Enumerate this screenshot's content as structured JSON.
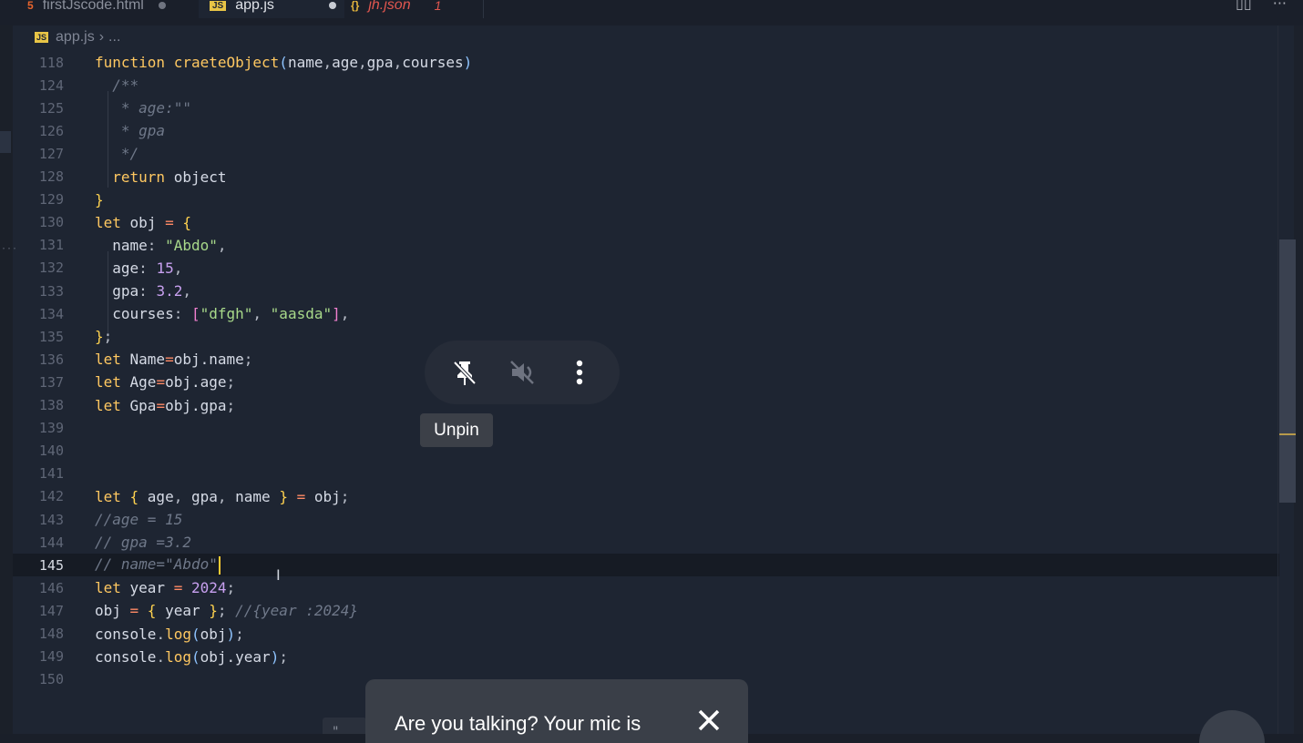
{
  "tabs": [
    {
      "label": "firstJscode.html",
      "icon": "html5-icon",
      "modified": true
    },
    {
      "label": "app.js",
      "icon": "js-file-icon",
      "modified": true,
      "active": true
    },
    {
      "label": "jh.json",
      "icon": "json-braces-icon",
      "problems": "1"
    }
  ],
  "breadcrumb": {
    "file": "app.js",
    "rest": "..."
  },
  "lines": [
    {
      "n": "118",
      "tokens": [
        [
          "kw",
          "function "
        ],
        [
          "fn",
          "craeteObject"
        ],
        [
          "par",
          "("
        ],
        [
          "id",
          "name"
        ],
        [
          "pu",
          ","
        ],
        [
          "id",
          "age"
        ],
        [
          "pu",
          ","
        ],
        [
          "id",
          "gpa"
        ],
        [
          "pu",
          ","
        ],
        [
          "id",
          "courses"
        ],
        [
          "par",
          ")"
        ]
      ]
    },
    {
      "n": "124",
      "tokens": [
        [
          "cm",
          "  /**"
        ]
      ]
    },
    {
      "n": "125",
      "tokens": [
        [
          "cm",
          "   * age:\"\""
        ]
      ]
    },
    {
      "n": "126",
      "tokens": [
        [
          "cm",
          "   * gpa"
        ]
      ]
    },
    {
      "n": "127",
      "tokens": [
        [
          "cm",
          "   */"
        ]
      ]
    },
    {
      "n": "128",
      "tokens": [
        [
          "kw",
          "  return "
        ],
        [
          "id",
          "object"
        ]
      ]
    },
    {
      "n": "129",
      "tokens": [
        [
          "br",
          "}"
        ]
      ]
    },
    {
      "n": "130",
      "tokens": [
        [
          "kw",
          "let "
        ],
        [
          "id",
          "obj "
        ],
        [
          "op",
          "= "
        ],
        [
          "br",
          "{"
        ]
      ]
    },
    {
      "n": "131",
      "tokens": [
        [
          "id",
          "  name"
        ],
        [
          "pu",
          ": "
        ],
        [
          "str",
          "\"Abdo\""
        ],
        [
          "pu",
          ","
        ]
      ]
    },
    {
      "n": "132",
      "tokens": [
        [
          "id",
          "  age"
        ],
        [
          "pu",
          ": "
        ],
        [
          "num",
          "15"
        ],
        [
          "pu",
          ","
        ]
      ]
    },
    {
      "n": "133",
      "tokens": [
        [
          "id",
          "  gpa"
        ],
        [
          "pu",
          ": "
        ],
        [
          "num",
          "3.2"
        ],
        [
          "pu",
          ","
        ]
      ]
    },
    {
      "n": "134",
      "tokens": [
        [
          "id",
          "  courses"
        ],
        [
          "pu",
          ": "
        ],
        [
          "sq",
          "["
        ],
        [
          "str",
          "\"dfgh\""
        ],
        [
          "pu",
          ", "
        ],
        [
          "str",
          "\"aasda\""
        ],
        [
          "sq",
          "]"
        ],
        [
          "pu",
          ","
        ]
      ]
    },
    {
      "n": "135",
      "tokens": [
        [
          "br",
          "}"
        ],
        [
          "pu",
          ";"
        ]
      ]
    },
    {
      "n": "136",
      "tokens": [
        [
          "kw",
          "let "
        ],
        [
          "id",
          "Name"
        ],
        [
          "op",
          "="
        ],
        [
          "id",
          "obj.name"
        ],
        [
          "pu",
          ";"
        ]
      ]
    },
    {
      "n": "137",
      "tokens": [
        [
          "kw",
          "let "
        ],
        [
          "id",
          "Age"
        ],
        [
          "op",
          "="
        ],
        [
          "id",
          "obj.age"
        ],
        [
          "pu",
          ";"
        ]
      ]
    },
    {
      "n": "138",
      "tokens": [
        [
          "kw",
          "let "
        ],
        [
          "id",
          "Gpa"
        ],
        [
          "op",
          "="
        ],
        [
          "id",
          "obj.gpa"
        ],
        [
          "pu",
          ";"
        ]
      ]
    },
    {
      "n": "139",
      "tokens": []
    },
    {
      "n": "140",
      "tokens": []
    },
    {
      "n": "141",
      "tokens": []
    },
    {
      "n": "142",
      "tokens": [
        [
          "kw",
          "let "
        ],
        [
          "br",
          "{ "
        ],
        [
          "id",
          "age"
        ],
        [
          "pu",
          ", "
        ],
        [
          "id",
          "gpa"
        ],
        [
          "pu",
          ", "
        ],
        [
          "id",
          "name "
        ],
        [
          "br",
          "} "
        ],
        [
          "op",
          "= "
        ],
        [
          "id",
          "obj"
        ],
        [
          "pu",
          ";"
        ]
      ]
    },
    {
      "n": "143",
      "tokens": [
        [
          "cm",
          "//age = 15"
        ]
      ]
    },
    {
      "n": "144",
      "tokens": [
        [
          "cm",
          "// gpa =3.2"
        ]
      ]
    },
    {
      "n": "145",
      "tokens": [
        [
          "cm",
          "// name=\"Abdo\""
        ]
      ],
      "current": true
    },
    {
      "n": "146",
      "tokens": [
        [
          "kw",
          "let "
        ],
        [
          "id",
          "year "
        ],
        [
          "op",
          "= "
        ],
        [
          "num",
          "2024"
        ],
        [
          "pu",
          ";"
        ]
      ]
    },
    {
      "n": "147",
      "tokens": [
        [
          "id",
          "obj "
        ],
        [
          "op",
          "= "
        ],
        [
          "br",
          "{ "
        ],
        [
          "id",
          "year "
        ],
        [
          "br",
          "}"
        ],
        [
          "pu",
          "; "
        ],
        [
          "cm",
          "//{year :2024}"
        ]
      ]
    },
    {
      "n": "148",
      "tokens": [
        [
          "id",
          "console"
        ],
        [
          "pu",
          "."
        ],
        [
          "fn",
          "log"
        ],
        [
          "par",
          "("
        ],
        [
          "id",
          "obj"
        ],
        [
          "par",
          ")"
        ],
        [
          "pu",
          ";"
        ]
      ]
    },
    {
      "n": "149",
      "tokens": [
        [
          "id",
          "console"
        ],
        [
          "pu",
          "."
        ],
        [
          "fn",
          "log"
        ],
        [
          "par",
          "("
        ],
        [
          "id",
          "obj.year"
        ],
        [
          "par",
          ")"
        ],
        [
          "pu",
          ";"
        ]
      ]
    },
    {
      "n": "150",
      "tokens": []
    }
  ],
  "overlay": {
    "buttons": [
      {
        "name": "unpin-icon"
      },
      {
        "name": "muted-speaker-icon"
      },
      {
        "name": "more-vert-icon"
      }
    ],
    "tooltip": "Unpin"
  },
  "toast": {
    "text": "Are you talking? Your mic is",
    "close_icon": "close-icon"
  },
  "colors": {
    "accent_yellow": "#ffc861",
    "editor_bg": "#1e2532",
    "comment": "#6f7889",
    "string": "#a8d98a",
    "number": "#c8a0f0"
  }
}
